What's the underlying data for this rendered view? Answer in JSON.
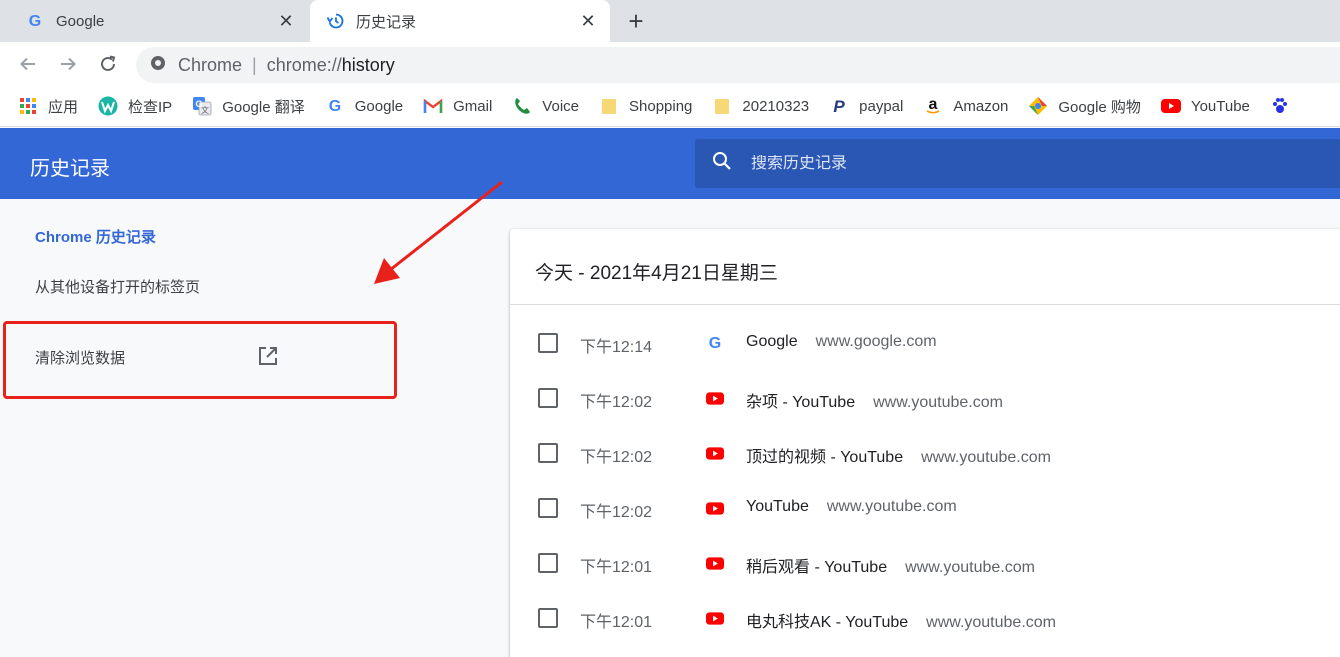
{
  "tabs": [
    {
      "title": "Google",
      "favicon": "google-g-icon",
      "active": false
    },
    {
      "title": "历史记录",
      "favicon": "history-icon",
      "active": true
    }
  ],
  "address_bar": {
    "site_label": "Chrome",
    "scheme": "chrome://",
    "path": "history"
  },
  "bookmarks": [
    {
      "label": "应用",
      "icon": "apps-grid-icon"
    },
    {
      "label": "检查IP",
      "icon": "w-logo-icon"
    },
    {
      "label": "Google 翻译",
      "icon": "google-translate-icon"
    },
    {
      "label": "Google",
      "icon": "google-g-icon"
    },
    {
      "label": "Gmail",
      "icon": "gmail-icon"
    },
    {
      "label": "Voice",
      "icon": "voice-phone-icon"
    },
    {
      "label": "Shopping",
      "icon": "folder-icon"
    },
    {
      "label": "20210323",
      "icon": "folder-icon"
    },
    {
      "label": "paypal",
      "icon": "paypal-icon"
    },
    {
      "label": "Amazon",
      "icon": "amazon-icon"
    },
    {
      "label": "Google 购物",
      "icon": "google-shopping-icon"
    },
    {
      "label": "YouTube",
      "icon": "youtube-icon"
    }
  ],
  "history_header": {
    "title": "历史记录",
    "search_placeholder": "搜索历史记录"
  },
  "sidebar": {
    "chrome_history": "Chrome 历史记录",
    "other_devices": "从其他设备打开的标签页",
    "clear_data": "清除浏览数据"
  },
  "card": {
    "date_title": "今天 - 2021年4月21日星期三",
    "entries": [
      {
        "time": "下午12:14",
        "title": "Google",
        "domain": "www.google.com",
        "favicon": "google-g-icon"
      },
      {
        "time": "下午12:02",
        "title": "杂项 - YouTube",
        "domain": "www.youtube.com",
        "favicon": "youtube-icon"
      },
      {
        "time": "下午12:02",
        "title": "顶过的视频 - YouTube",
        "domain": "www.youtube.com",
        "favicon": "youtube-icon"
      },
      {
        "time": "下午12:02",
        "title": "YouTube",
        "domain": "www.youtube.com",
        "favicon": "youtube-icon"
      },
      {
        "time": "下午12:01",
        "title": "稍后观看 - YouTube",
        "domain": "www.youtube.com",
        "favicon": "youtube-icon"
      },
      {
        "time": "下午12:01",
        "title": "电丸科技AK - YouTube",
        "domain": "www.youtube.com",
        "favicon": "youtube-icon"
      }
    ]
  },
  "colors": {
    "header_blue": "#3367d6",
    "search_blue": "#2a56b4",
    "annotation_red": "#e8221b",
    "youtube_red": "#ff0000"
  }
}
